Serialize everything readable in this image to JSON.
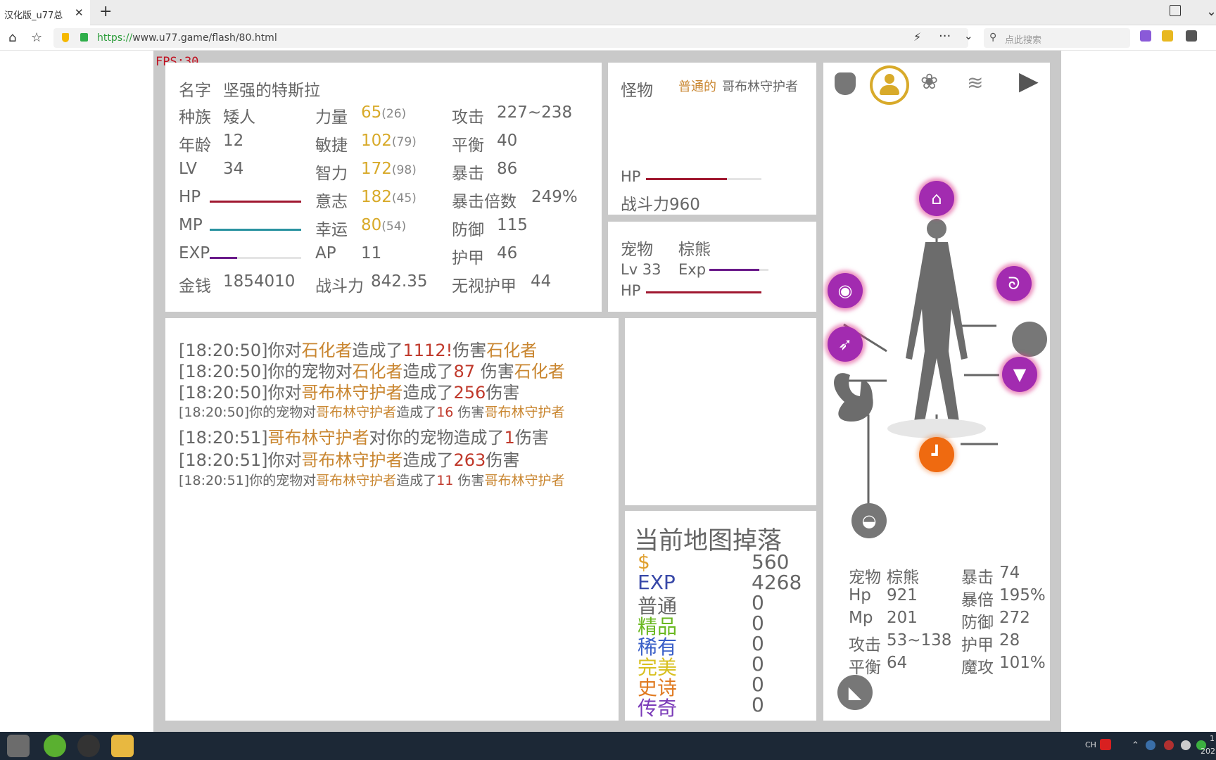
{
  "browser": {
    "tab_title": "汉化版_u77总",
    "tab_close": "✕",
    "new_tab": "+",
    "url_scheme": "https://",
    "url_rest": "www.u77.game/flash/80.html",
    "search_placeholder": "点此搜索",
    "icons": [
      "home-icon",
      "star-list-icon",
      "shield-icon",
      "lock-icon",
      "bolt-icon",
      "more-icon",
      "chevron-down-icon",
      "search-icon"
    ]
  },
  "game": {
    "fps": "FPS:30",
    "character": {
      "name_label": "名字",
      "name_value": "坚强的特斯拉",
      "race_label": "种族",
      "race_value": "矮人",
      "age_label": "年龄",
      "age_value": "12",
      "lv_label": "LV",
      "lv_value": "34",
      "hp_label": "HP",
      "hp_progress": 1.0,
      "mp_label": "MP",
      "mp_progress": 1.0,
      "exp_label": "EXP",
      "exp_progress": 0.3,
      "money_label": "金钱",
      "money_value": "1854010",
      "str_label": "力量",
      "str_value": "65",
      "str_base": "(26)",
      "agi_label": "敏捷",
      "agi_value": "102",
      "agi_base": "(79)",
      "int_label": "智力",
      "int_value": "172",
      "int_base": "(98)",
      "will_label": "意志",
      "will_value": "182",
      "will_base": "(45)",
      "luck_label": "幸运",
      "luck_value": "80",
      "luck_base": "(54)",
      "ap_label": "AP",
      "ap_value": "11",
      "power_label": "战斗力",
      "power_value": "842.35",
      "atk_label": "攻击",
      "atk_value": "227~238",
      "bal_label": "平衡",
      "bal_value": "40",
      "crit_label": "暴击",
      "crit_value": "86",
      "critmul_label": "暴击倍数",
      "critmul_value": "249%",
      "def_label": "防御",
      "def_value": "115",
      "armor_label": "护甲",
      "armor_value": "46",
      "ignore_label": "无视护甲",
      "ignore_value": "44"
    },
    "monster": {
      "label": "怪物",
      "quality": "普通的",
      "name": "哥布林守护者",
      "hp_label": "HP",
      "hp_progress": 0.7,
      "power_text": "战斗力960"
    },
    "pet": {
      "label": "宠物",
      "name": "棕熊",
      "lv_text": "Lv 33",
      "exp_label": "Exp",
      "exp_progress": 0.85,
      "hp_label": "HP",
      "hp_progress": 1.0
    },
    "log": [
      {
        "parts": [
          [
            "t",
            "[18:20:50]你对"
          ],
          [
            "o",
            "石化者"
          ],
          [
            "t",
            "造成了"
          ],
          [
            "r",
            "1112!"
          ],
          [
            "t",
            "伤害"
          ],
          [
            "o",
            "石化者"
          ]
        ]
      },
      {
        "parts": [
          [
            "t",
            "[18:20:50]你的宠物对"
          ],
          [
            "o",
            "石化者"
          ],
          [
            "t",
            "造成了"
          ],
          [
            "r",
            "87"
          ],
          [
            "t",
            " 伤害"
          ],
          [
            "o",
            "石化者"
          ]
        ]
      },
      {
        "parts": [
          [
            "t",
            "[18:20:50]你对"
          ],
          [
            "o",
            "哥布林守护者"
          ],
          [
            "t",
            "造成了"
          ],
          [
            "r",
            "256"
          ],
          [
            "t",
            "伤害"
          ]
        ]
      },
      {
        "parts": [
          [
            "t",
            "[18:20:50]你的宠物对"
          ],
          [
            "o",
            "哥布林守护者"
          ],
          [
            "t",
            "造成了"
          ],
          [
            "r",
            "16"
          ],
          [
            "t",
            " 伤害"
          ],
          [
            "o",
            "哥布林守护者"
          ]
        ]
      },
      {
        "parts": [
          [
            "t",
            "[18:20:51]"
          ],
          [
            "o",
            "哥布林守护者"
          ],
          [
            "t",
            "对你的宠物造成了"
          ],
          [
            "r",
            "1"
          ],
          [
            "t",
            "伤害"
          ]
        ]
      },
      {
        "parts": [
          [
            "t",
            "[18:20:51]你对"
          ],
          [
            "o",
            "哥布林守护者"
          ],
          [
            "t",
            "造成了"
          ],
          [
            "r",
            "263"
          ],
          [
            "t",
            "伤害"
          ]
        ]
      },
      {
        "parts": [
          [
            "t",
            "[18:20:51]你的宠物对"
          ],
          [
            "o",
            "哥布林守护者"
          ],
          [
            "t",
            "造成了"
          ],
          [
            "r",
            "11"
          ],
          [
            "t",
            " 伤害"
          ],
          [
            "o",
            "哥布林守护者"
          ]
        ]
      }
    ],
    "drops": {
      "title": "当前地图掉落",
      "rows": [
        {
          "key": "$",
          "value": "560",
          "color": "#e0a030"
        },
        {
          "key": "EXP",
          "value": "4268",
          "color": "#3848a8"
        },
        {
          "key": "普通",
          "value": "0",
          "color": "#666666"
        },
        {
          "key": "精品",
          "value": "0",
          "color": "#6ab820"
        },
        {
          "key": "稀有",
          "value": "0",
          "color": "#3a5fc8"
        },
        {
          "key": "完美",
          "value": "0",
          "color": "#d8c020"
        },
        {
          "key": "史诗",
          "value": "0",
          "color": "#e07a20"
        },
        {
          "key": "传奇",
          "value": "0",
          "color": "#7a3ab8"
        }
      ]
    },
    "pet_stats": {
      "pet_label": "宠物",
      "pet_name": "棕熊",
      "hp_label": "Hp",
      "hp_value": "921",
      "mp_label": "Mp",
      "mp_value": "201",
      "atk_label": "攻击",
      "atk_value": "53~138",
      "bal_label": "平衡",
      "bal_value": "64",
      "crit_label": "暴击",
      "crit_value": "74",
      "critmul_label": "暴倍",
      "critmul_value": "195%",
      "def_label": "防御",
      "def_value": "272",
      "armor_label": "护甲",
      "armor_value": "28",
      "magic_label": "魔攻",
      "magic_value": "101%"
    },
    "colors": {
      "hp": "#a01830",
      "mp": "#2a93a0",
      "exp": "#6a1a8a",
      "purple_slot": "#a22bb0",
      "orange_slot": "#ef6a10",
      "gold": "#d8aa2a",
      "accent_ring": "#d8aa2a"
    },
    "taskbar": {
      "tray_lang": "CH",
      "clock_top": "1",
      "clock_bottom": "202"
    }
  }
}
